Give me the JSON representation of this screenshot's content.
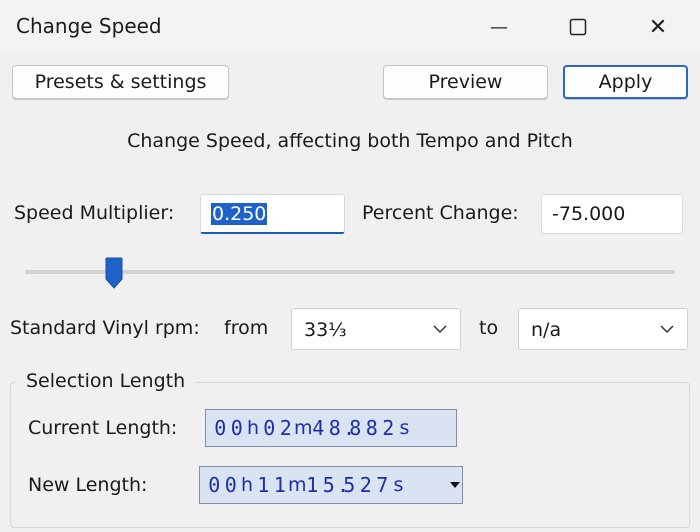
{
  "window": {
    "title": "Change Speed",
    "minimize_glyph": "—",
    "close_glyph": "✕"
  },
  "toolbar": {
    "presets_label": "Presets & settings",
    "preview_label": "Preview",
    "apply_label": "Apply"
  },
  "heading": "Change Speed, affecting both Tempo and Pitch",
  "speed": {
    "multiplier_label": "Speed Multiplier:",
    "multiplier_value": "0.250",
    "percent_label": "Percent Change:",
    "percent_value": "-75.000",
    "slider_fraction": 0.137
  },
  "vinyl": {
    "label": "Standard Vinyl rpm:",
    "from_label": "from",
    "from_value": "33⅓",
    "to_label": "to",
    "to_value": "n/a"
  },
  "selection": {
    "group_title": "Selection Length",
    "current_label": "Current Length:",
    "current_value": "00h02m48.882s",
    "new_label": "New Length:",
    "new_value": "00h11m15.527s"
  },
  "colors": {
    "accent": "#1e62c9",
    "timebox_bg": "#d9e3f1",
    "timebox_text": "#1c2fa8"
  },
  "icons": {
    "maximize": "maximize-icon",
    "chevron": "chevron-down-icon",
    "dropdown": "dropdown-triangle-icon",
    "slider": "slider-thumb-icon"
  }
}
